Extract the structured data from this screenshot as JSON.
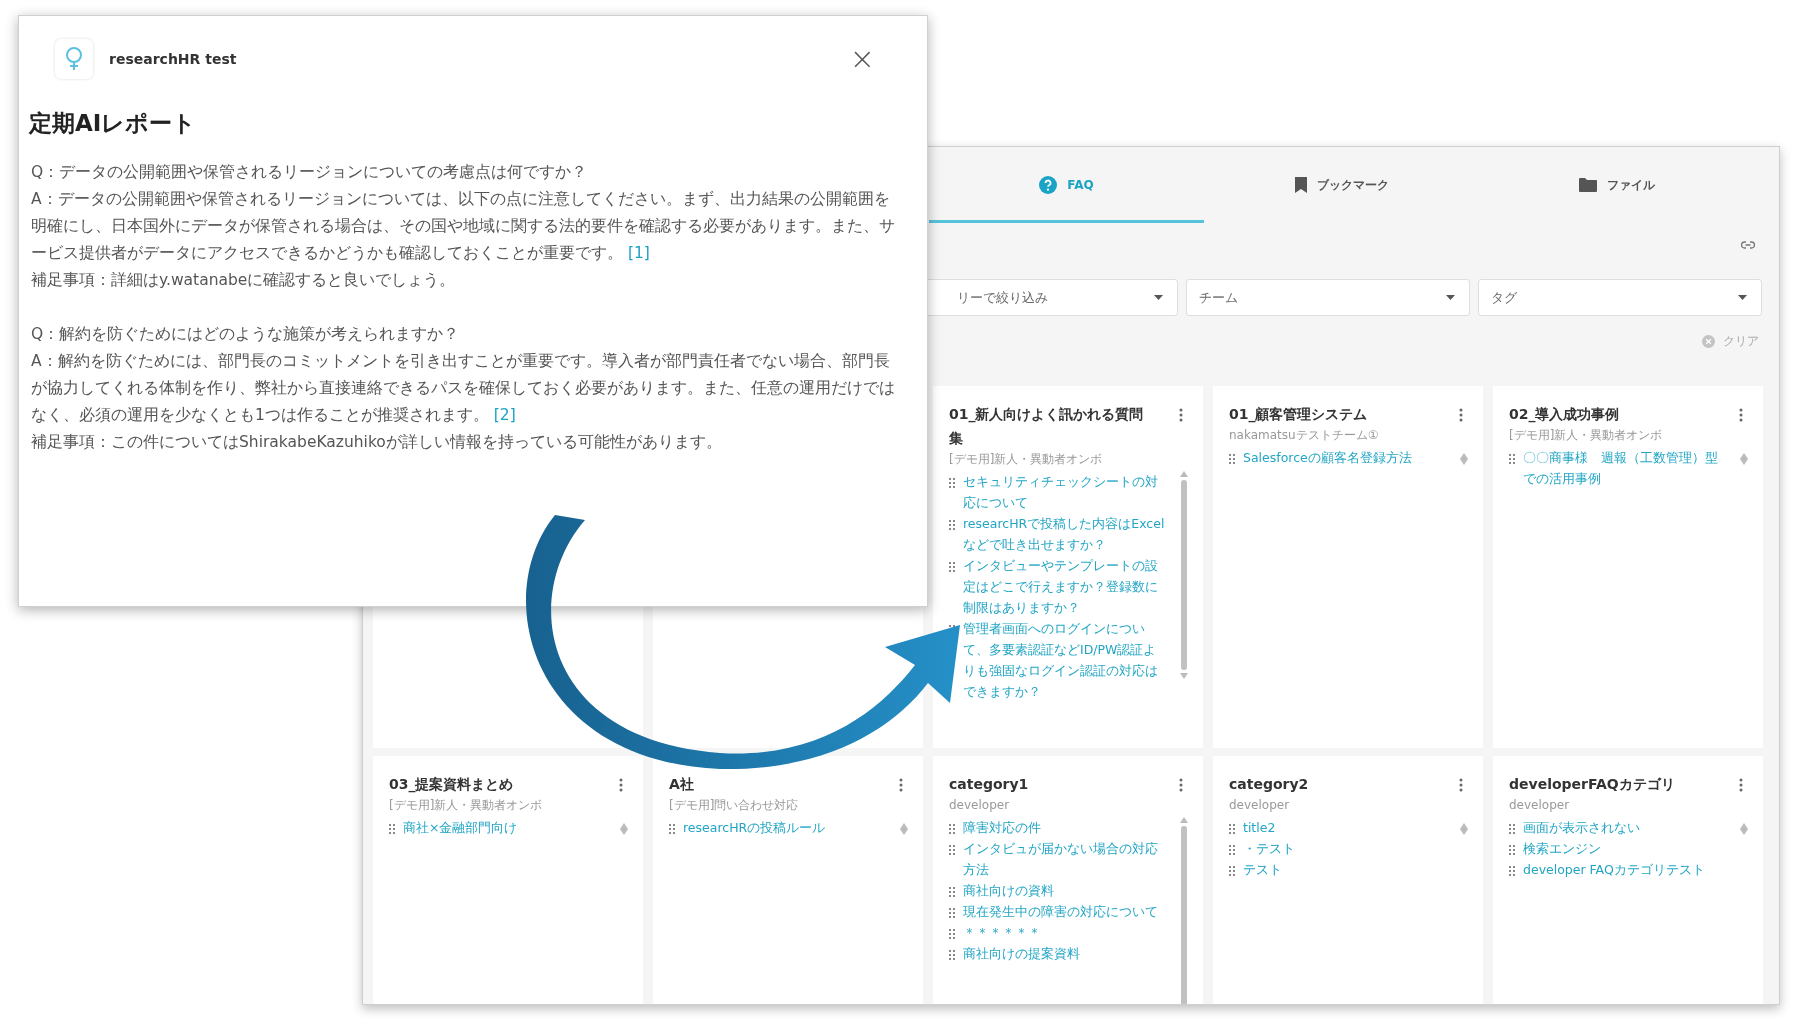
{
  "dialog": {
    "app_name": "researchHR test",
    "close": "×",
    "title": "定期AIレポート",
    "blocks": [
      {
        "question": "Q：データの公開範囲や保管されるリージョンについての考慮点は何ですか？",
        "answer": "A：データの公開範囲や保管されるリージョンについては、以下の点に注意してください。まず、出力結果の公開範囲を明確にし、日本国外にデータが保管される場合は、その国や地域に関する法的要件を確認する必要があります。また、サービス提供者がデータにアクセスできるかどうかも確認しておくことが重要です。",
        "ref": "[1]",
        "note": "補足事項：詳細はy.watanabeに確認すると良いでしょう。"
      },
      {
        "question": "Q：解約を防ぐためにはどのような施策が考えられますか？",
        "answer": "A：解約を防ぐためには、部門長のコミットメントを引き出すことが重要です。導入者が部門責任者でない場合、部門長が協力してくれる体制を作り、弊社から直接連絡できるパスを確保しておく必要があります。また、任意の運用だけではなく、必須の運用を少なくとも1つは作ることが推奨されます。",
        "ref": "[2]",
        "note": "補足事項：この件についてはShirakabeKazuhikoが詳しい情報を持っている可能性があります。"
      }
    ]
  },
  "panel": {
    "tabs": [
      {
        "label": "FAQ",
        "selected": true
      },
      {
        "label": "ブックマーク",
        "selected": false
      },
      {
        "label": "ファイル",
        "selected": false
      }
    ],
    "filters": [
      {
        "placeholder": "リーで絞り込み"
      },
      {
        "placeholder": "チーム"
      },
      {
        "placeholder": "タグ"
      }
    ],
    "clear": "クリア",
    "cards": [
      {
        "title": "01_新人向けよく訊かれる質問集",
        "team": "[デモ用]新人・異動者オンボ",
        "kind": "scrolling",
        "items": [
          "セキュリティチェックシートの対応について",
          "researcHRで投稿した内容はExcelなどで吐き出せますか？",
          "インタビューやテンプレートの設定はどこで行えますか？登録数に制限はありますか？",
          "管理者画面へのログインについて、多要素認証などID/PW認証よりも強固なログイン認証の対応はできますか？"
        ]
      },
      {
        "title": "01_顧客管理システム",
        "team": "nakamatsuテストチーム①",
        "kind": "short",
        "items": [
          "Salesforceの顧客名登録方法"
        ]
      },
      {
        "title": "02_導入成功事例",
        "team": "[デモ用]新人・異動者オンボ",
        "kind": "short",
        "items": [
          "〇〇商事様　週報（工数管理）型での活用事例"
        ]
      },
      {
        "title": "03_提案資料まとめ",
        "team": "[デモ用]新人・異動者オンボ",
        "kind": "short",
        "items": [
          "商社×金融部門向け"
        ]
      },
      {
        "title": "A社",
        "team": "[デモ用]問い合わせ対応",
        "kind": "short",
        "items": [
          "researcHRの投稿ルール"
        ]
      },
      {
        "title": "category1",
        "team": "developer",
        "kind": "scrolling",
        "items": [
          "障害対応の件",
          "インタビュが届かない場合の対応方法",
          "商社向けの資料",
          "現在発生中の障害の対応について",
          "＊＊＊＊＊＊",
          "商社向けの提案資料"
        ]
      },
      {
        "title": "category2",
        "team": "developer",
        "kind": "short",
        "items": [
          "title2",
          "・テスト",
          "テスト"
        ]
      },
      {
        "title": "developerFAQカテゴリ",
        "team": "developer",
        "kind": "short",
        "items": [
          "画面が表示されない",
          "検索エンジン",
          "developer FAQカテゴリテスト"
        ]
      }
    ]
  }
}
